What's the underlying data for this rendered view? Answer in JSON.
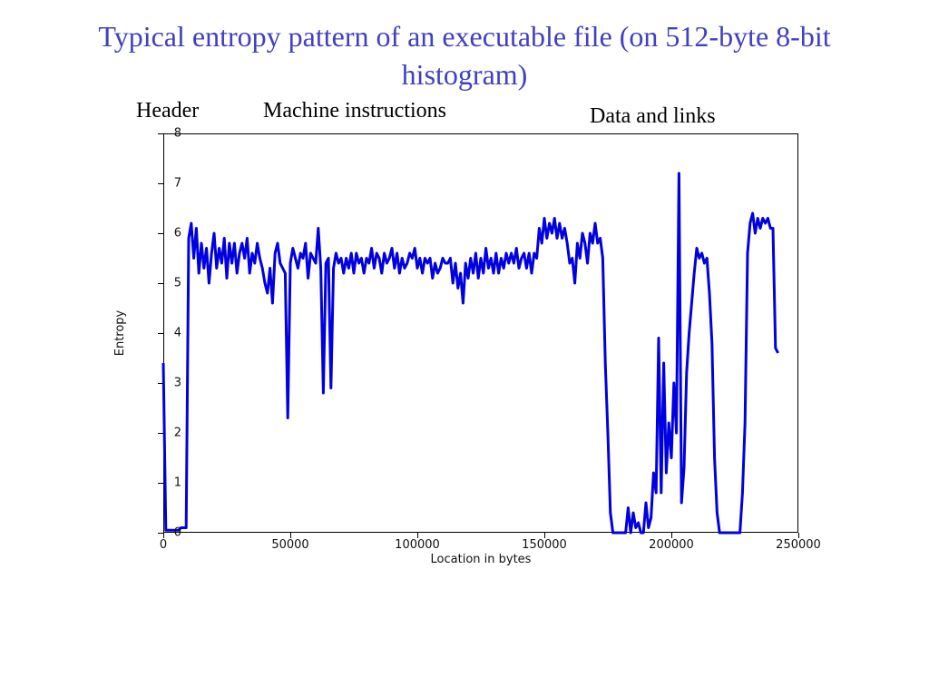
{
  "title": "Typical entropy pattern of an executable file (on 512-byte 8-bit histogram)",
  "segments": {
    "header": "Header",
    "instructions": "Machine instructions",
    "data_links": "Data and links"
  },
  "chart_data": {
    "type": "line",
    "title": "",
    "xlabel": "Location in bytes",
    "ylabel": "Entropy",
    "xlim": [
      0,
      250000
    ],
    "ylim": [
      0,
      8
    ],
    "xticks": [
      0,
      50000,
      100000,
      150000,
      200000,
      250000
    ],
    "yticks": [
      0,
      1,
      2,
      3,
      4,
      5,
      6,
      7,
      8
    ],
    "series": [
      {
        "name": "entropy",
        "data": [
          [
            0,
            3.4
          ],
          [
            1000,
            0.05
          ],
          [
            2000,
            0.05
          ],
          [
            3000,
            0.05
          ],
          [
            4000,
            0.05
          ],
          [
            5000,
            0.05
          ],
          [
            6000,
            0.05
          ],
          [
            7000,
            0.1
          ],
          [
            8000,
            0.1
          ],
          [
            9000,
            0.1
          ],
          [
            10000,
            5.9
          ],
          [
            11000,
            6.2
          ],
          [
            12000,
            5.5
          ],
          [
            13000,
            6.1
          ],
          [
            14000,
            5.2
          ],
          [
            15000,
            5.8
          ],
          [
            16000,
            5.3
          ],
          [
            17000,
            5.7
          ],
          [
            18000,
            5.0
          ],
          [
            19000,
            5.6
          ],
          [
            20000,
            6.0
          ],
          [
            21000,
            5.3
          ],
          [
            22000,
            5.7
          ],
          [
            23000,
            5.4
          ],
          [
            24000,
            5.9
          ],
          [
            25000,
            5.1
          ],
          [
            26000,
            5.8
          ],
          [
            27000,
            5.4
          ],
          [
            28000,
            5.8
          ],
          [
            29000,
            5.2
          ],
          [
            30000,
            5.6
          ],
          [
            31000,
            5.8
          ],
          [
            32000,
            5.5
          ],
          [
            33000,
            5.9
          ],
          [
            34000,
            5.2
          ],
          [
            35000,
            5.6
          ],
          [
            36000,
            5.4
          ],
          [
            37000,
            5.8
          ],
          [
            38000,
            5.5
          ],
          [
            39000,
            5.3
          ],
          [
            40000,
            5.0
          ],
          [
            41000,
            4.8
          ],
          [
            42000,
            5.3
          ],
          [
            43000,
            4.6
          ],
          [
            44000,
            5.6
          ],
          [
            45000,
            5.8
          ],
          [
            46000,
            5.4
          ],
          [
            47000,
            5.3
          ],
          [
            48000,
            5.2
          ],
          [
            49000,
            2.3
          ],
          [
            50000,
            5.4
          ],
          [
            51000,
            5.7
          ],
          [
            52000,
            5.5
          ],
          [
            53000,
            5.3
          ],
          [
            54000,
            5.6
          ],
          [
            55000,
            5.5
          ],
          [
            56000,
            5.8
          ],
          [
            57000,
            5.1
          ],
          [
            58000,
            5.6
          ],
          [
            59000,
            5.5
          ],
          [
            60000,
            5.4
          ],
          [
            61000,
            6.1
          ],
          [
            62000,
            5.3
          ],
          [
            63000,
            2.8
          ],
          [
            64000,
            5.4
          ],
          [
            65000,
            5.5
          ],
          [
            66000,
            2.9
          ],
          [
            67000,
            5.3
          ],
          [
            68000,
            5.6
          ],
          [
            69000,
            5.4
          ],
          [
            70000,
            5.5
          ],
          [
            71000,
            5.2
          ],
          [
            72000,
            5.5
          ],
          [
            73000,
            5.3
          ],
          [
            74000,
            5.6
          ],
          [
            75000,
            5.2
          ],
          [
            76000,
            5.6
          ],
          [
            77000,
            5.4
          ],
          [
            78000,
            5.5
          ],
          [
            79000,
            5.2
          ],
          [
            80000,
            5.5
          ],
          [
            81000,
            5.4
          ],
          [
            82000,
            5.7
          ],
          [
            83000,
            5.3
          ],
          [
            84000,
            5.6
          ],
          [
            85000,
            5.5
          ],
          [
            86000,
            5.2
          ],
          [
            87000,
            5.6
          ],
          [
            88000,
            5.4
          ],
          [
            89000,
            5.5
          ],
          [
            90000,
            5.7
          ],
          [
            91000,
            5.3
          ],
          [
            92000,
            5.6
          ],
          [
            93000,
            5.2
          ],
          [
            94000,
            5.5
          ],
          [
            95000,
            5.3
          ],
          [
            96000,
            5.4
          ],
          [
            97000,
            5.6
          ],
          [
            98000,
            5.5
          ],
          [
            99000,
            5.7
          ],
          [
            100000,
            5.3
          ],
          [
            101000,
            5.5
          ],
          [
            102000,
            5.2
          ],
          [
            103000,
            5.5
          ],
          [
            104000,
            5.4
          ],
          [
            105000,
            5.5
          ],
          [
            106000,
            5.1
          ],
          [
            107000,
            5.4
          ],
          [
            108000,
            5.2
          ],
          [
            109000,
            5.3
          ],
          [
            110000,
            5.5
          ],
          [
            111000,
            5.4
          ],
          [
            112000,
            5.4
          ],
          [
            113000,
            5.5
          ],
          [
            114000,
            5.0
          ],
          [
            115000,
            5.4
          ],
          [
            116000,
            4.9
          ],
          [
            117000,
            5.2
          ],
          [
            118000,
            4.6
          ],
          [
            119000,
            5.4
          ],
          [
            120000,
            5.1
          ],
          [
            121000,
            5.5
          ],
          [
            122000,
            5.2
          ],
          [
            123000,
            5.6
          ],
          [
            124000,
            5.1
          ],
          [
            125000,
            5.5
          ],
          [
            126000,
            5.2
          ],
          [
            127000,
            5.7
          ],
          [
            128000,
            5.3
          ],
          [
            129000,
            5.5
          ],
          [
            130000,
            5.2
          ],
          [
            131000,
            5.6
          ],
          [
            132000,
            5.2
          ],
          [
            133000,
            5.5
          ],
          [
            134000,
            5.3
          ],
          [
            135000,
            5.6
          ],
          [
            136000,
            5.4
          ],
          [
            137000,
            5.6
          ],
          [
            138000,
            5.4
          ],
          [
            139000,
            5.7
          ],
          [
            140000,
            5.3
          ],
          [
            141000,
            5.5
          ],
          [
            142000,
            5.6
          ],
          [
            143000,
            5.3
          ],
          [
            144000,
            5.6
          ],
          [
            145000,
            5.2
          ],
          [
            146000,
            5.6
          ],
          [
            147000,
            5.5
          ],
          [
            148000,
            6.1
          ],
          [
            149000,
            5.8
          ],
          [
            150000,
            6.3
          ],
          [
            151000,
            5.9
          ],
          [
            152000,
            6.2
          ],
          [
            153000,
            6.0
          ],
          [
            154000,
            6.3
          ],
          [
            155000,
            5.9
          ],
          [
            156000,
            6.2
          ],
          [
            157000,
            5.9
          ],
          [
            158000,
            6.1
          ],
          [
            159000,
            5.8
          ],
          [
            160000,
            5.4
          ],
          [
            161000,
            5.5
          ],
          [
            162000,
            5.0
          ],
          [
            163000,
            5.8
          ],
          [
            164000,
            5.5
          ],
          [
            165000,
            6.0
          ],
          [
            166000,
            5.8
          ],
          [
            167000,
            5.4
          ],
          [
            168000,
            6.0
          ],
          [
            169000,
            5.8
          ],
          [
            170000,
            6.2
          ],
          [
            171000,
            5.8
          ],
          [
            172000,
            5.9
          ],
          [
            173000,
            5.5
          ],
          [
            174000,
            3.4
          ],
          [
            175000,
            2.0
          ],
          [
            176000,
            0.4
          ],
          [
            177000,
            0.0
          ],
          [
            178000,
            0.0
          ],
          [
            179000,
            0.0
          ],
          [
            180000,
            0.0
          ],
          [
            181000,
            0.0
          ],
          [
            182000,
            0.0
          ],
          [
            183000,
            0.5
          ],
          [
            184000,
            0.0
          ],
          [
            185000,
            0.4
          ],
          [
            186000,
            0.1
          ],
          [
            187000,
            0.2
          ],
          [
            188000,
            0.0
          ],
          [
            189000,
            0.0
          ],
          [
            190000,
            0.6
          ],
          [
            191000,
            0.1
          ],
          [
            192000,
            0.3
          ],
          [
            193000,
            1.2
          ],
          [
            194000,
            0.8
          ],
          [
            195000,
            3.9
          ],
          [
            196000,
            0.8
          ],
          [
            197000,
            3.4
          ],
          [
            198000,
            1.2
          ],
          [
            199000,
            2.2
          ],
          [
            200000,
            1.5
          ],
          [
            201000,
            3.0
          ],
          [
            202000,
            2.0
          ],
          [
            203000,
            7.2
          ],
          [
            204000,
            0.6
          ],
          [
            205000,
            1.3
          ],
          [
            206000,
            3.2
          ],
          [
            207000,
            4.0
          ],
          [
            208000,
            4.6
          ],
          [
            209000,
            5.2
          ],
          [
            210000,
            5.7
          ],
          [
            211000,
            5.5
          ],
          [
            212000,
            5.6
          ],
          [
            213000,
            5.4
          ],
          [
            214000,
            5.5
          ],
          [
            215000,
            4.8
          ],
          [
            216000,
            3.8
          ],
          [
            217000,
            1.5
          ],
          [
            218000,
            0.4
          ],
          [
            219000,
            0.0
          ],
          [
            220000,
            0.0
          ],
          [
            221000,
            0.0
          ],
          [
            222000,
            0.0
          ],
          [
            223000,
            0.0
          ],
          [
            224000,
            0.0
          ],
          [
            225000,
            0.0
          ],
          [
            226000,
            0.0
          ],
          [
            227000,
            0.0
          ],
          [
            228000,
            0.8
          ],
          [
            229000,
            2.2
          ],
          [
            230000,
            5.6
          ],
          [
            231000,
            6.2
          ],
          [
            232000,
            6.4
          ],
          [
            233000,
            6.0
          ],
          [
            234000,
            6.3
          ],
          [
            235000,
            6.1
          ],
          [
            236000,
            6.3
          ],
          [
            237000,
            6.2
          ],
          [
            238000,
            6.3
          ],
          [
            239000,
            6.1
          ],
          [
            240000,
            6.1
          ],
          [
            241000,
            3.7
          ],
          [
            242000,
            3.6
          ]
        ]
      }
    ]
  }
}
